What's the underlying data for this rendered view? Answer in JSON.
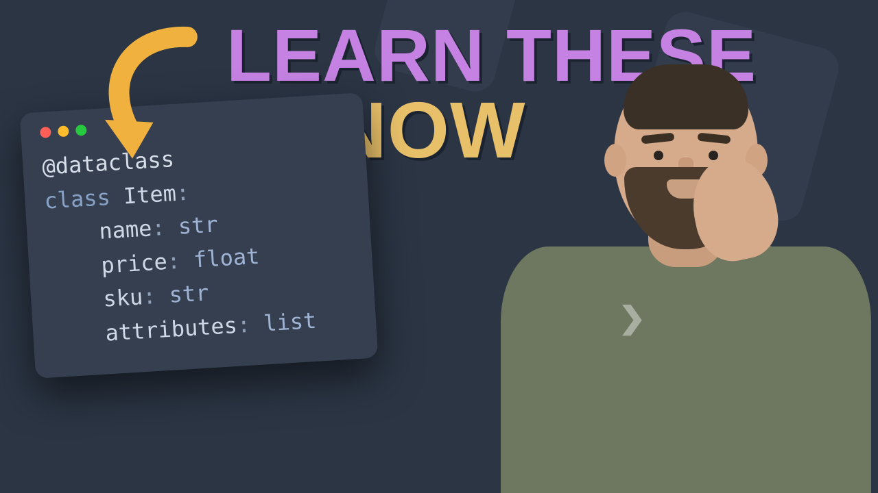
{
  "headline": {
    "line1": "LEARN THESE",
    "line2": "NOW"
  },
  "code": {
    "decorator": "@dataclass",
    "class_keyword": "class",
    "class_name": "Item",
    "colon": ":",
    "fields": [
      {
        "name": "name",
        "type": "str"
      },
      {
        "name": "price",
        "type": "float"
      },
      {
        "name": "sku",
        "type": "str"
      },
      {
        "name": "attributes",
        "type": "list"
      }
    ]
  },
  "traffic_lights": [
    "red",
    "yellow",
    "green"
  ],
  "arrow": {
    "name": "curved-arrow-icon",
    "color": "#f0b13e"
  }
}
